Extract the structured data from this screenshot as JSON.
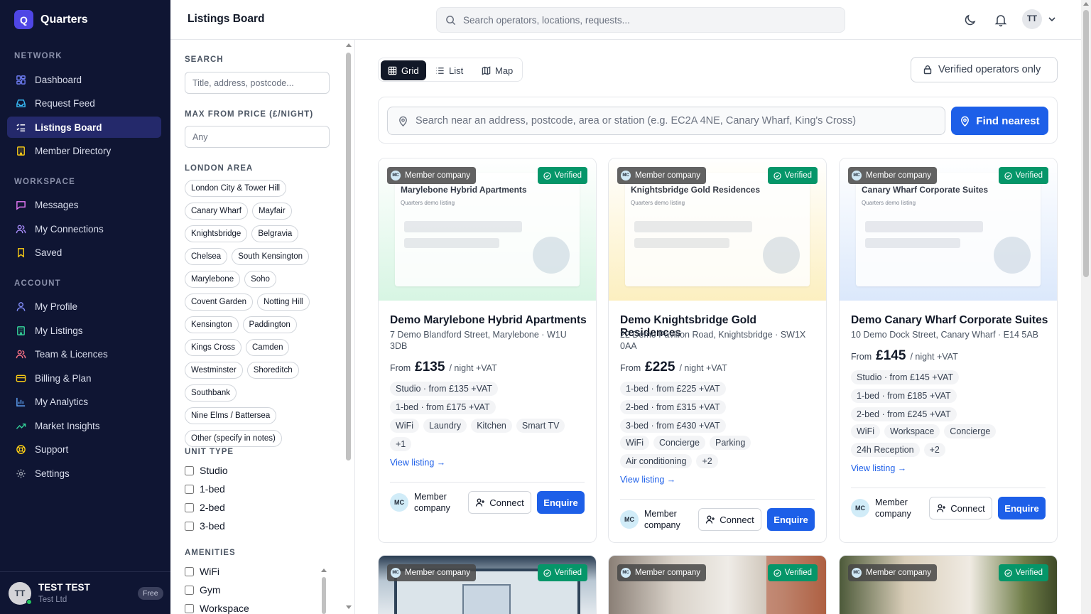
{
  "app": {
    "logo_letter": "Q",
    "name": "Quarters"
  },
  "sidebar": {
    "sections": {
      "network": "NETWORK",
      "workspace": "WORKSPACE",
      "account": "ACCOUNT"
    },
    "network_items": [
      {
        "label": "Dashboard",
        "icon": "dashboard-icon"
      },
      {
        "label": "Request Feed",
        "icon": "inbox-icon"
      },
      {
        "label": "Listings Board",
        "icon": "list-checks-icon",
        "active": true
      },
      {
        "label": "Member Directory",
        "icon": "building-icon"
      }
    ],
    "workspace_items": [
      {
        "label": "Messages",
        "icon": "message-icon"
      },
      {
        "label": "My Connections",
        "icon": "users-icon"
      },
      {
        "label": "Saved",
        "icon": "bookmark-icon"
      }
    ],
    "account_items": [
      {
        "label": "My Profile",
        "icon": "user-icon"
      },
      {
        "label": "My Listings",
        "icon": "building-icon"
      },
      {
        "label": "Team & Licences",
        "icon": "team-icon"
      },
      {
        "label": "Billing & Plan",
        "icon": "credit-card-icon"
      },
      {
        "label": "My Analytics",
        "icon": "bar-chart-icon"
      },
      {
        "label": "Market Insights",
        "icon": "trending-up-icon"
      },
      {
        "label": "Support",
        "icon": "life-buoy-icon"
      },
      {
        "label": "Settings",
        "icon": "gear-icon"
      }
    ],
    "user": {
      "initials": "TT",
      "name": "TEST TEST",
      "company": "Test Ltd",
      "plan": "Free"
    }
  },
  "topbar": {
    "title": "Listings Board",
    "search_placeholder": "Search operators, locations, requests...",
    "avatar_initials": "TT"
  },
  "filters": {
    "search_label": "SEARCH",
    "search_placeholder": "Title, address, postcode...",
    "max_price_label": "MAX FROM PRICE (£/NIGHT)",
    "max_price_placeholder": "Any",
    "area_label": "LONDON AREA",
    "areas": [
      "London City & Tower Hill",
      "Canary Wharf",
      "Mayfair",
      "Knightsbridge",
      "Belgravia",
      "Chelsea",
      "South Kensington",
      "Marylebone",
      "Soho",
      "Covent Garden",
      "Notting Hill",
      "Kensington",
      "Paddington",
      "Kings Cross",
      "Camden",
      "Westminster",
      "Shoreditch",
      "Southbank",
      "Nine Elms / Battersea",
      "Other (specify in notes)"
    ],
    "unit_type_label": "UNIT TYPE",
    "unit_types": [
      "Studio",
      "1-bed",
      "2-bed",
      "3-bed"
    ],
    "amenities_label": "AMENITIES",
    "amenities": [
      "WiFi",
      "Gym",
      "Workspace"
    ]
  },
  "main": {
    "views": [
      "Grid",
      "List",
      "Map"
    ],
    "active_view": "Grid",
    "verified_only_label": "Verified operators only",
    "near_placeholder": "Search near an address, postcode, area or station (e.g. EC2A 4NE, Canary Wharf, King's Cross)",
    "find_nearest_label": "Find nearest"
  },
  "cards": [
    {
      "member_badge": "Member company",
      "verified_badge": "Verified",
      "thumb_title": "Marylebone Hybrid Apartments",
      "thumb_sub": "Quarters demo listing",
      "thumb_color": "#d7f5e3",
      "title": "Demo Marylebone Hybrid Apartments",
      "address": "7 Demo Blandford Street, Marylebone · W1U 3DB",
      "price_from": "From",
      "price": "£135",
      "price_unit": "/ night +VAT",
      "units": [
        "Studio · from £135 +VAT",
        "1-bed · from £175 +VAT"
      ],
      "amenities": [
        "WiFi",
        "Laundry",
        "Kitchen",
        "Smart TV",
        "+1"
      ],
      "view_link": "View listing →",
      "operator_initials": "MC",
      "operator": "Member company",
      "connect": "Connect",
      "enquire": "Enquire"
    },
    {
      "member_badge": "Member company",
      "verified_badge": "Verified",
      "thumb_title": "Knightsbridge Gold Residences",
      "thumb_sub": "Quarters demo listing",
      "thumb_color": "#fcefc0",
      "title": "Demo Knightsbridge Gold Residences",
      "address": "22 Demo Pavilion Road, Knightsbridge · SW1X 0AA",
      "price_from": "From",
      "price": "£225",
      "price_unit": "/ night +VAT",
      "units": [
        "1-bed · from £225 +VAT",
        "2-bed · from £315 +VAT",
        "3-bed · from £430 +VAT"
      ],
      "amenities": [
        "WiFi",
        "Concierge",
        "Parking",
        "Air conditioning",
        "+2"
      ],
      "view_link": "View listing →",
      "operator_initials": "MC",
      "operator": "Member company",
      "connect": "Connect",
      "enquire": "Enquire"
    },
    {
      "member_badge": "Member company",
      "verified_badge": "Verified",
      "thumb_title": "Canary Wharf Corporate Suites",
      "thumb_sub": "Quarters demo listing",
      "thumb_color": "#dbe8fb",
      "title": "Demo Canary Wharf Corporate Suites",
      "address": "10 Demo Dock Street, Canary Wharf · E14 5AB",
      "price_from": "From",
      "price": "£145",
      "price_unit": "/ night +VAT",
      "units": [
        "Studio · from £145 +VAT",
        "1-bed · from £185 +VAT",
        "2-bed · from £245 +VAT"
      ],
      "amenities": [
        "WiFi",
        "Workspace",
        "Concierge",
        "24h Reception",
        "+2"
      ],
      "view_link": "View listing →",
      "operator_initials": "MC",
      "operator": "Member company",
      "connect": "Connect",
      "enquire": "Enquire"
    }
  ],
  "second_row": [
    {
      "member_badge": "Member company",
      "verified_badge": "Verified"
    },
    {
      "member_badge": "Member company",
      "verified_badge": "Verified"
    },
    {
      "member_badge": "Member company",
      "verified_badge": "Verified"
    }
  ],
  "colors": {
    "sidebar_bg": "#0f1533",
    "accent": "#1d5fe8",
    "verified": "#059669",
    "active_item": "#24296b"
  }
}
